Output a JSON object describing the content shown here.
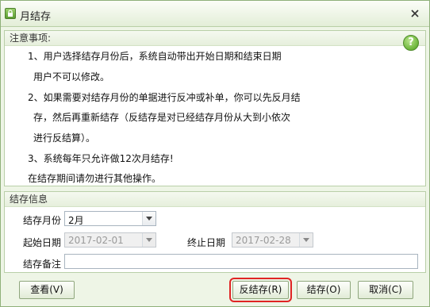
{
  "window": {
    "title": "月结存"
  },
  "notes": {
    "header": "注意事项:",
    "lines": [
      "1、用户选择结存月份后，系统自动带出开始日期和结束日期",
      "用户不可以修改。",
      "2、如果需要对结存月份的单据进行反冲或补单，你可以先反月结",
      "存，然后再重新结存（反结存是对已经结存月份从大到小依次",
      "进行反结算）。",
      "3、系统每年只允许做12次月结存!",
      "在结存期间请勿进行其他操作。"
    ],
    "help_glyph": "?"
  },
  "info": {
    "header": "结存信息",
    "month_label": "结存月份",
    "month_value": "2月",
    "start_label": "起始日期",
    "start_value": "2017-02-01",
    "end_label": "终止日期",
    "end_value": "2017-02-28",
    "remark_label": "结存备注",
    "remark_value": ""
  },
  "buttons": {
    "view": "查看(V)",
    "unsettle": "反结存(R)",
    "settle": "结存(O)",
    "cancel": "取消(C)"
  }
}
